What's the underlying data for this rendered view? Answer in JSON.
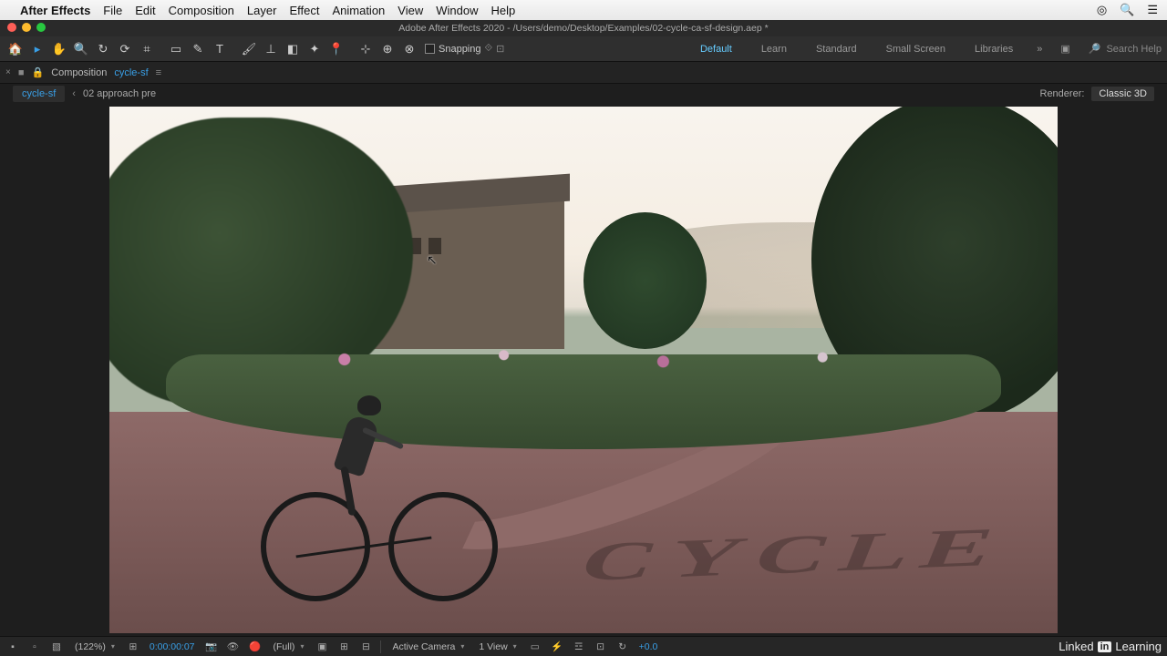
{
  "mac_menu": {
    "app": "After Effects",
    "items": [
      "File",
      "Edit",
      "Composition",
      "Layer",
      "Effect",
      "Animation",
      "View",
      "Window",
      "Help"
    ]
  },
  "window": {
    "title": "Adobe After Effects 2020 - /Users/demo/Desktop/Examples/02-cycle-ca-sf-design.aep *"
  },
  "toolbar": {
    "home_icon": "home",
    "snapping_label": "Snapping",
    "workspaces": {
      "default": "Default",
      "learn": "Learn",
      "standard": "Standard",
      "small": "Small Screen",
      "libraries": "Libraries"
    },
    "search_placeholder": "Search Help"
  },
  "comp_panel": {
    "label": "Composition",
    "comp_name": "cycle-sf"
  },
  "breadcrumb": {
    "tab1": "cycle-sf",
    "chevron": "‹",
    "tab2": "02 approach pre",
    "renderer_label": "Renderer:",
    "renderer_value": "Classic 3D"
  },
  "viewer": {
    "overlay_text": "CYCLE"
  },
  "footer": {
    "zoom": "(122%)",
    "timecode": "0:00:00:07",
    "resolution": "(Full)",
    "camera": "Active Camera",
    "views": "1 View",
    "exposure": "+0.0"
  },
  "brand": {
    "linked": "Linked",
    "in": "in",
    "learning": "Learning"
  }
}
